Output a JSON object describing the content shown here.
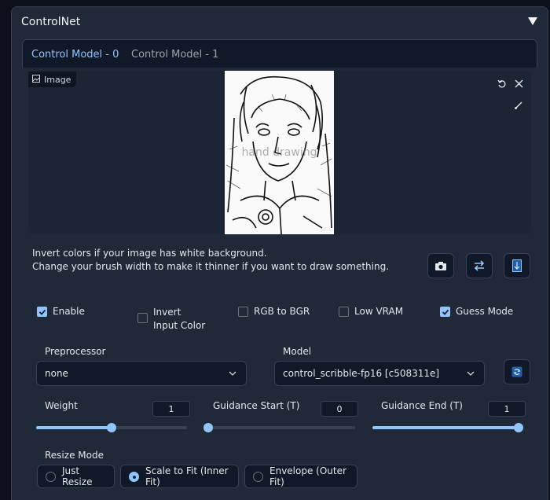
{
  "accordion": {
    "title": "ControlNet"
  },
  "tabs": [
    {
      "label": "Control Model - 0",
      "active": true
    },
    {
      "label": "Control Model - 1",
      "active": false
    }
  ],
  "image_panel": {
    "label": "Image",
    "overlay_text": "hand drawing"
  },
  "hints": {
    "line1": "Invert colors if your image has white background.",
    "line2": "Change your brush width to make it thinner if you want to draw something."
  },
  "checkboxes": [
    {
      "label": "Enable",
      "checked": true
    },
    {
      "label": "Invert Input Color",
      "checked": false
    },
    {
      "label": "RGB to BGR",
      "checked": false
    },
    {
      "label": "Low VRAM",
      "checked": false
    },
    {
      "label": "Guess Mode",
      "checked": true
    }
  ],
  "preprocessor": {
    "label": "Preprocessor",
    "value": "none"
  },
  "model": {
    "label": "Model",
    "value": "control_scribble-fp16 [c508311e]"
  },
  "sliders": [
    {
      "label": "Weight",
      "value": "1",
      "fraction": 0.5
    },
    {
      "label": "Guidance Start (T)",
      "value": "0",
      "fraction": 0.0
    },
    {
      "label": "Guidance End (T)",
      "value": "1",
      "fraction": 1.0
    }
  ],
  "resize_mode": {
    "label": "Resize Mode",
    "options": [
      {
        "label": "Just Resize",
        "selected": false
      },
      {
        "label": "Scale to Fit (Inner Fit)",
        "selected": true
      },
      {
        "label": "Envelope (Outer Fit)",
        "selected": false
      }
    ]
  },
  "colors": {
    "accent": "#93c5fd",
    "panel": "#1f2937",
    "background": "#0b0f19"
  }
}
